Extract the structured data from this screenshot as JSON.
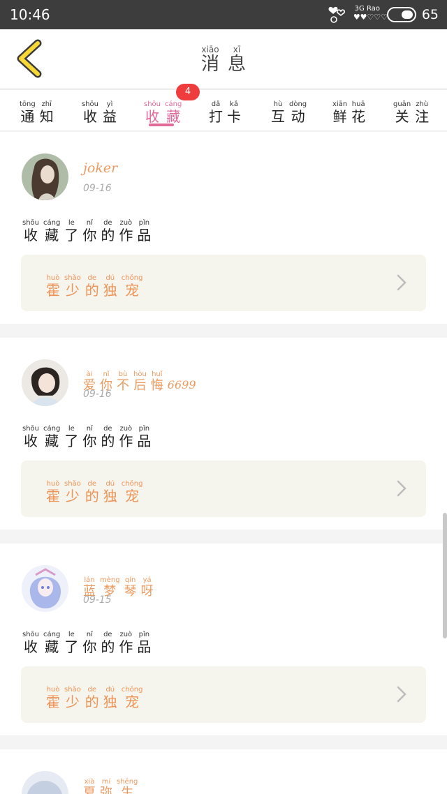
{
  "status_bar": {
    "time": "10:46",
    "network": "3G",
    "network_sub": "Rao",
    "battery": "65"
  },
  "header": {
    "title": [
      {
        "py": "xiāo",
        "hz": "消"
      },
      {
        "py": "xī",
        "hz": "息"
      }
    ]
  },
  "tabs": [
    {
      "chars": [
        {
          "py": "tōng",
          "hz": "通"
        },
        {
          "py": "zhī",
          "hz": "知"
        }
      ],
      "active": false
    },
    {
      "chars": [
        {
          "py": "shōu",
          "hz": "收"
        },
        {
          "py": "yì",
          "hz": "益"
        }
      ],
      "active": false
    },
    {
      "chars": [
        {
          "py": "shōu",
          "hz": "收"
        },
        {
          "py": "cáng",
          "hz": "藏"
        }
      ],
      "active": true
    },
    {
      "chars": [
        {
          "py": "dǎ",
          "hz": "打"
        },
        {
          "py": "kǎ",
          "hz": "卡"
        }
      ],
      "active": false
    },
    {
      "chars": [
        {
          "py": "hù",
          "hz": "互"
        },
        {
          "py": "dòng",
          "hz": "动"
        }
      ],
      "active": false
    },
    {
      "chars": [
        {
          "py": "xiān",
          "hz": "鲜"
        },
        {
          "py": "huā",
          "hz": "花"
        }
      ],
      "active": false
    },
    {
      "chars": [
        {
          "py": "guān",
          "hz": "关"
        },
        {
          "py": "zhù",
          "hz": "注"
        }
      ],
      "active": false
    }
  ],
  "tab_badge": "4",
  "action_text": [
    {
      "py": "shōu",
      "hz": "收"
    },
    {
      "py": "cáng",
      "hz": "藏"
    },
    {
      "py": "le",
      "hz": "了"
    },
    {
      "py": "nǐ",
      "hz": "你"
    },
    {
      "py": "de",
      "hz": "的"
    },
    {
      "py": "zuò",
      "hz": "作"
    },
    {
      "py": "pǐn",
      "hz": "品"
    }
  ],
  "work_title": [
    {
      "py": "huò",
      "hz": "霍"
    },
    {
      "py": "shǎo",
      "hz": "少"
    },
    {
      "py": "de",
      "hz": "的"
    },
    {
      "py": "dú",
      "hz": "独"
    },
    {
      "py": "chǒng",
      "hz": "宠"
    }
  ],
  "cards": [
    {
      "username_plain": "joker",
      "username": [],
      "date": "09-16",
      "avatar": "girl-curly-hair-avatar"
    },
    {
      "username_plain": "",
      "username": [
        {
          "py": "ài",
          "hz": "爱"
        },
        {
          "py": "nǐ",
          "hz": "你"
        },
        {
          "py": "bù",
          "hz": "不"
        },
        {
          "py": "hòu",
          "hz": "后"
        },
        {
          "py": "huǐ",
          "hz": "悔"
        }
      ],
      "username_suffix": "6699",
      "date": "09-16",
      "avatar": "girl-short-hair-avatar"
    },
    {
      "username_plain": "",
      "username": [
        {
          "py": "lán",
          "hz": "蓝"
        },
        {
          "py": "mèng",
          "hz": "梦"
        },
        {
          "py": "qín",
          "hz": "琴"
        },
        {
          "py": "yá",
          "hz": "呀"
        }
      ],
      "date": "09-15",
      "avatar": "anime-girl-avatar"
    },
    {
      "username_plain": "",
      "username": [
        {
          "py": "xià",
          "hz": "夏"
        },
        {
          "py": "mí",
          "hz": "弥"
        },
        {
          "py": "shēng",
          "hz": "生"
        }
      ],
      "date": "",
      "avatar": "partial-avatar"
    }
  ],
  "colors": {
    "accent_pink": "#e0679a",
    "badge_red": "#ef3d3d",
    "orange_text": "#ee9356",
    "back_arrow_yellow": "#f7d836"
  }
}
